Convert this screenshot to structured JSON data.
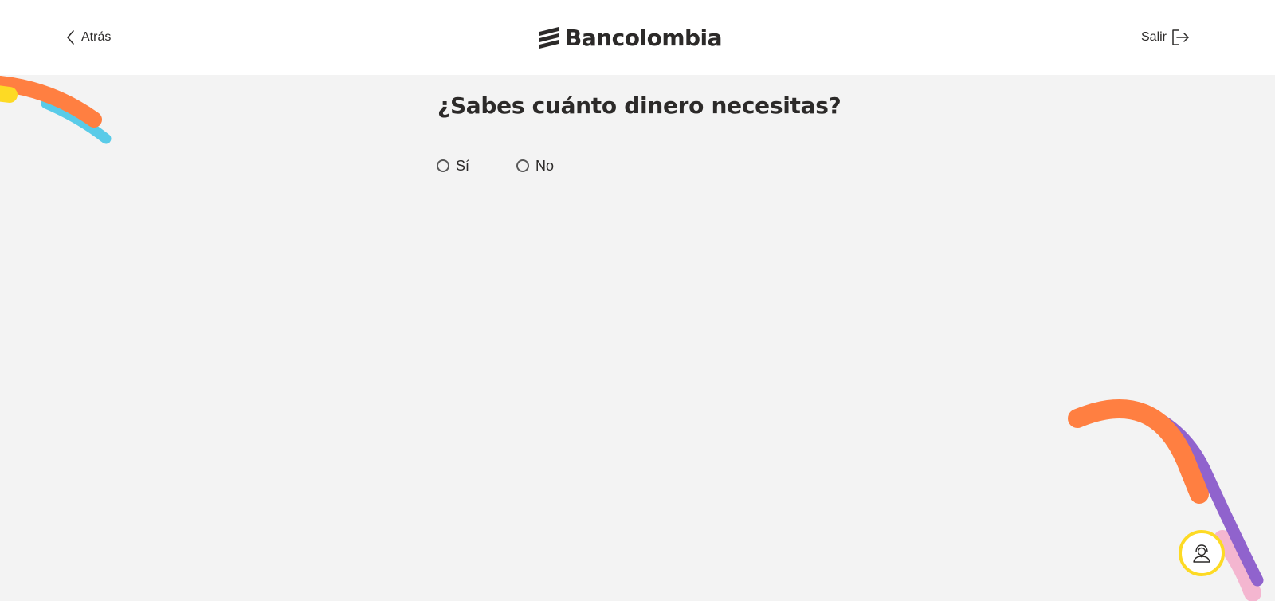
{
  "header": {
    "back_label": "Atrás",
    "brand_name": "Bancolombia",
    "exit_label": "Salir"
  },
  "question": {
    "title": "¿Sabes cuánto dinero necesitas?",
    "options": [
      {
        "label": "Sí",
        "selected": false
      },
      {
        "label": "No",
        "selected": false
      }
    ]
  },
  "help": {
    "icon": "support-agent-icon"
  },
  "colors": {
    "page_background": "#f3f3f3",
    "header_background": "#ffffff",
    "text": "#2c2a29",
    "brand_yellow": "#fdda24",
    "accent_orange": "#ff7f41",
    "accent_blue": "#59cbe8",
    "accent_purple": "#9063cd",
    "accent_pink": "#f4b6d0"
  }
}
